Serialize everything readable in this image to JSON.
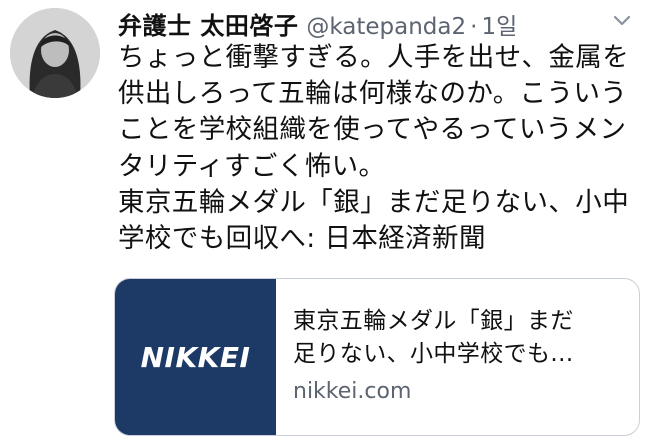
{
  "author": {
    "display_name": "弁護士 太田啓子",
    "handle": "@katepanda2",
    "separator": "·",
    "time": "1일"
  },
  "menu": {
    "icon": "chevron-down-icon"
  },
  "tweet": {
    "lines": [
      "ちょっと衝撃すぎる。人手を出せ、金属を",
      "供出しろって五輪は何様なのか。こういう",
      "ことを学校組織を使ってやるっていうメン",
      "タリティすごく怖い。",
      "東京五輪メダル「銀」まだ足りない、小中",
      "学校でも回収へ: 日本経済新聞"
    ]
  },
  "link_card": {
    "logo_text": "NIKKEI",
    "title_lines": [
      "東京五輪メダル「銀」まだ",
      "足りない、小中学校でも..."
    ],
    "domain": "nikkei.com",
    "thumb_color": "#1d3a66"
  }
}
